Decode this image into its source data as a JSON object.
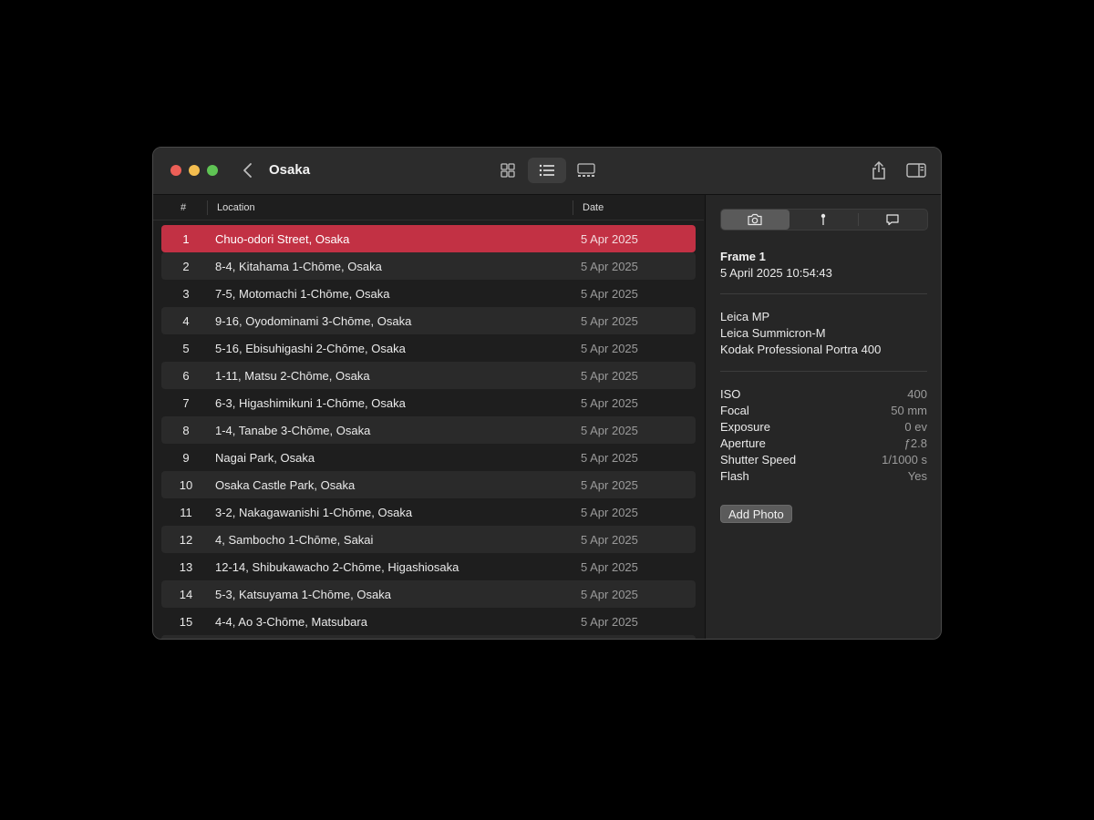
{
  "window": {
    "title": "Osaka"
  },
  "toolbar": {
    "views": [
      "grid-view",
      "list-view",
      "gallery-view"
    ],
    "active_view": "list-view"
  },
  "table": {
    "headers": {
      "num": "#",
      "location": "Location",
      "date": "Date"
    },
    "selected_index": 0,
    "rows": [
      {
        "num": "1",
        "location": "Chuo-odori Street, Osaka",
        "date": "5 Apr 2025"
      },
      {
        "num": "2",
        "location": "8-4, Kitahama 1-Chōme, Osaka",
        "date": "5 Apr 2025"
      },
      {
        "num": "3",
        "location": "7-5, Motomachi 1-Chōme, Osaka",
        "date": "5 Apr 2025"
      },
      {
        "num": "4",
        "location": "9-16, Oyodominami 3-Chōme, Osaka",
        "date": "5 Apr 2025"
      },
      {
        "num": "5",
        "location": "5-16, Ebisuhigashi 2-Chōme, Osaka",
        "date": "5 Apr 2025"
      },
      {
        "num": "6",
        "location": "1-11, Matsu 2-Chōme, Osaka",
        "date": "5 Apr 2025"
      },
      {
        "num": "7",
        "location": "6-3, Higashimikuni 1-Chōme, Osaka",
        "date": "5 Apr 2025"
      },
      {
        "num": "8",
        "location": "1-4, Tanabe 3-Chōme, Osaka",
        "date": "5 Apr 2025"
      },
      {
        "num": "9",
        "location": "Nagai Park, Osaka",
        "date": "5 Apr 2025"
      },
      {
        "num": "10",
        "location": "Osaka Castle Park, Osaka",
        "date": "5 Apr 2025"
      },
      {
        "num": "11",
        "location": "3-2, Nakagawanishi 1-Chōme, Osaka",
        "date": "5 Apr 2025"
      },
      {
        "num": "12",
        "location": "4, Sambocho 1-Chōme, Sakai",
        "date": "5 Apr 2025"
      },
      {
        "num": "13",
        "location": "12-14, Shibukawacho 2-Chōme, Higashiosaka",
        "date": "5 Apr 2025"
      },
      {
        "num": "14",
        "location": "5-3, Katsuyama 1-Chōme, Osaka",
        "date": "5 Apr 2025"
      },
      {
        "num": "15",
        "location": "4-4, Ao 3-Chōme, Matsubara",
        "date": "5 Apr 2025"
      }
    ]
  },
  "inspector": {
    "tabs": [
      "camera-tab",
      "location-tab",
      "comments-tab"
    ],
    "active_tab": "camera-tab",
    "frame_title": "Frame 1",
    "frame_datetime": "5 April 2025  10:54:43",
    "gear": [
      "Leica MP",
      "Leica Summicron-M",
      "Kodak Professional Portra 400"
    ],
    "settings": [
      {
        "key": "ISO",
        "value": "400"
      },
      {
        "key": "Focal",
        "value": "50 mm"
      },
      {
        "key": "Exposure",
        "value": "0 ev"
      },
      {
        "key": "Aperture",
        "value": "ƒ2.8"
      },
      {
        "key": "Shutter Speed",
        "value": "1/1000 s"
      },
      {
        "key": "Flash",
        "value": "Yes"
      }
    ],
    "add_photo_label": "Add Photo"
  },
  "colors": {
    "selection": "#c23144",
    "window_bg": "#1e1e1e",
    "inspector_bg": "#262626"
  }
}
